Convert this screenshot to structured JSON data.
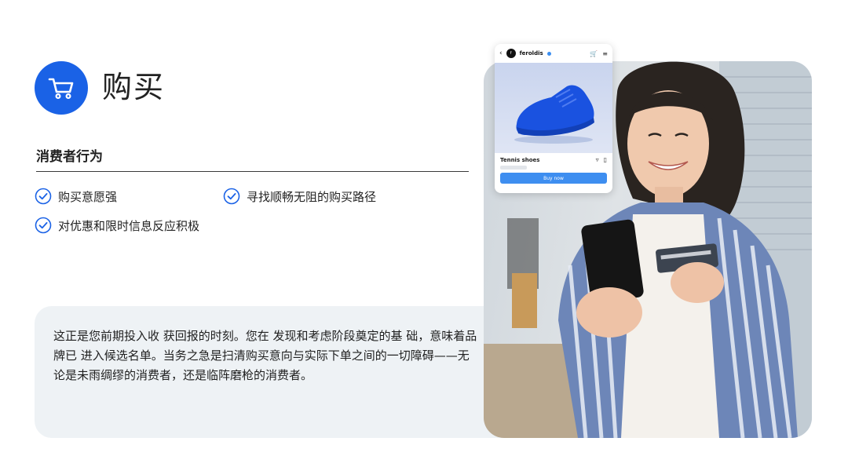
{
  "header": {
    "title": "购买",
    "icon": "shopping-cart-icon",
    "accent_color": "#1a62e6"
  },
  "section": {
    "heading": "消费者行为",
    "items": [
      {
        "label": "购买意愿强",
        "icon": "check-circle-icon"
      },
      {
        "label": "寻找顺畅无阻的购买路径",
        "icon": "check-circle-icon"
      },
      {
        "label": "对优惠和限时信息反应积极",
        "icon": "check-circle-icon"
      }
    ]
  },
  "description": {
    "text": "这正是您前期投入收 获回报的时刻。您在 发现和考虑阶段奠定的基 础，意味着品牌已 进入候选名单。当务之急是扫清购买意向与实际下单之间的一切障碍——无论是未雨绸缪的消费者，还是临阵磨枪的消费者。"
  },
  "phone_ui": {
    "account": "feroldis",
    "product_name": "Tennis shoes",
    "buy_label": "Buy now"
  }
}
